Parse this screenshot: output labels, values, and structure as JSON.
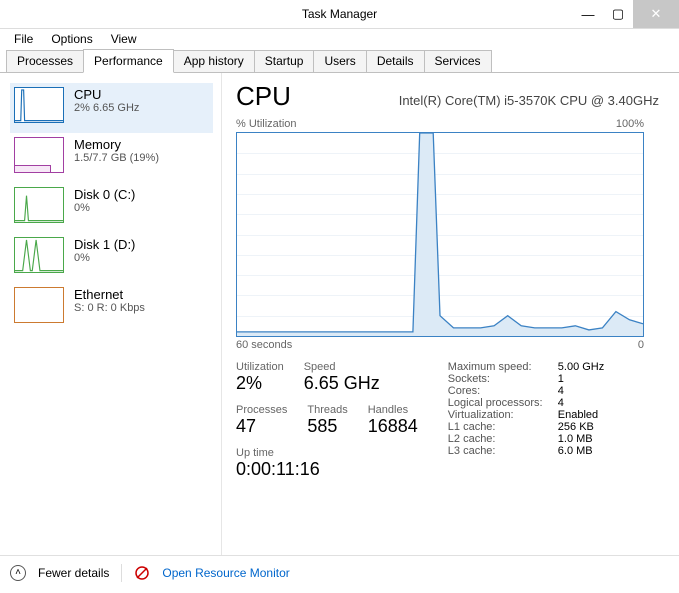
{
  "window": {
    "title": "Task Manager"
  },
  "menu": {
    "file": "File",
    "options": "Options",
    "view": "View"
  },
  "tabs": {
    "processes": "Processes",
    "performance": "Performance",
    "app_history": "App history",
    "startup": "Startup",
    "users": "Users",
    "details": "Details",
    "services": "Services"
  },
  "sidebar": {
    "cpu": {
      "title": "CPU",
      "sub": "2% 6.65 GHz"
    },
    "mem": {
      "title": "Memory",
      "sub": "1.5/7.7 GB (19%)"
    },
    "disk0": {
      "title": "Disk 0 (C:)",
      "sub": "0%"
    },
    "disk1": {
      "title": "Disk 1 (D:)",
      "sub": "0%"
    },
    "eth": {
      "title": "Ethernet",
      "sub": "S: 0 R: 0 Kbps"
    }
  },
  "header": {
    "title": "CPU",
    "sub": "Intel(R) Core(TM) i5-3570K CPU @ 3.40GHz"
  },
  "chart_axis": {
    "ytitle": "% Utilization",
    "ymax": "100%",
    "x_left": "60 seconds",
    "x_right": "0"
  },
  "stats": {
    "util_label": "Utilization",
    "util_val": "2%",
    "speed_label": "Speed",
    "speed_val": "6.65 GHz",
    "proc_label": "Processes",
    "proc_val": "47",
    "thr_label": "Threads",
    "thr_val": "585",
    "hnd_label": "Handles",
    "hnd_val": "16884",
    "up_label": "Up time",
    "up_val": "0:00:11:16"
  },
  "details": {
    "maxspeed_k": "Maximum speed:",
    "maxspeed_v": "5.00 GHz",
    "sockets_k": "Sockets:",
    "sockets_v": "1",
    "cores_k": "Cores:",
    "cores_v": "4",
    "logical_k": "Logical processors:",
    "logical_v": "4",
    "virt_k": "Virtualization:",
    "virt_v": "Enabled",
    "l1_k": "L1 cache:",
    "l1_v": "256 KB",
    "l2_k": "L2 cache:",
    "l2_v": "1.0 MB",
    "l3_k": "L3 cache:",
    "l3_v": "6.0 MB"
  },
  "footer": {
    "fewer": "Fewer details",
    "resmon": "Open Resource Monitor"
  },
  "chart_data": {
    "type": "line",
    "title": "% Utilization",
    "xlabel": "seconds",
    "ylabel": "% Utilization",
    "xlim": [
      60,
      0
    ],
    "ylim": [
      0,
      100
    ],
    "x": [
      60,
      58,
      56,
      54,
      52,
      50,
      48,
      46,
      44,
      42,
      40,
      38,
      36,
      34,
      33,
      32,
      31,
      30,
      28,
      26,
      24,
      22,
      20,
      18,
      16,
      14,
      12,
      10,
      8,
      6,
      4,
      2,
      0
    ],
    "values": [
      2,
      2,
      2,
      2,
      2,
      2,
      2,
      2,
      2,
      2,
      2,
      2,
      2,
      2,
      100,
      100,
      100,
      10,
      4,
      4,
      4,
      5,
      10,
      5,
      4,
      4,
      4,
      5,
      3,
      4,
      12,
      8,
      6
    ]
  }
}
